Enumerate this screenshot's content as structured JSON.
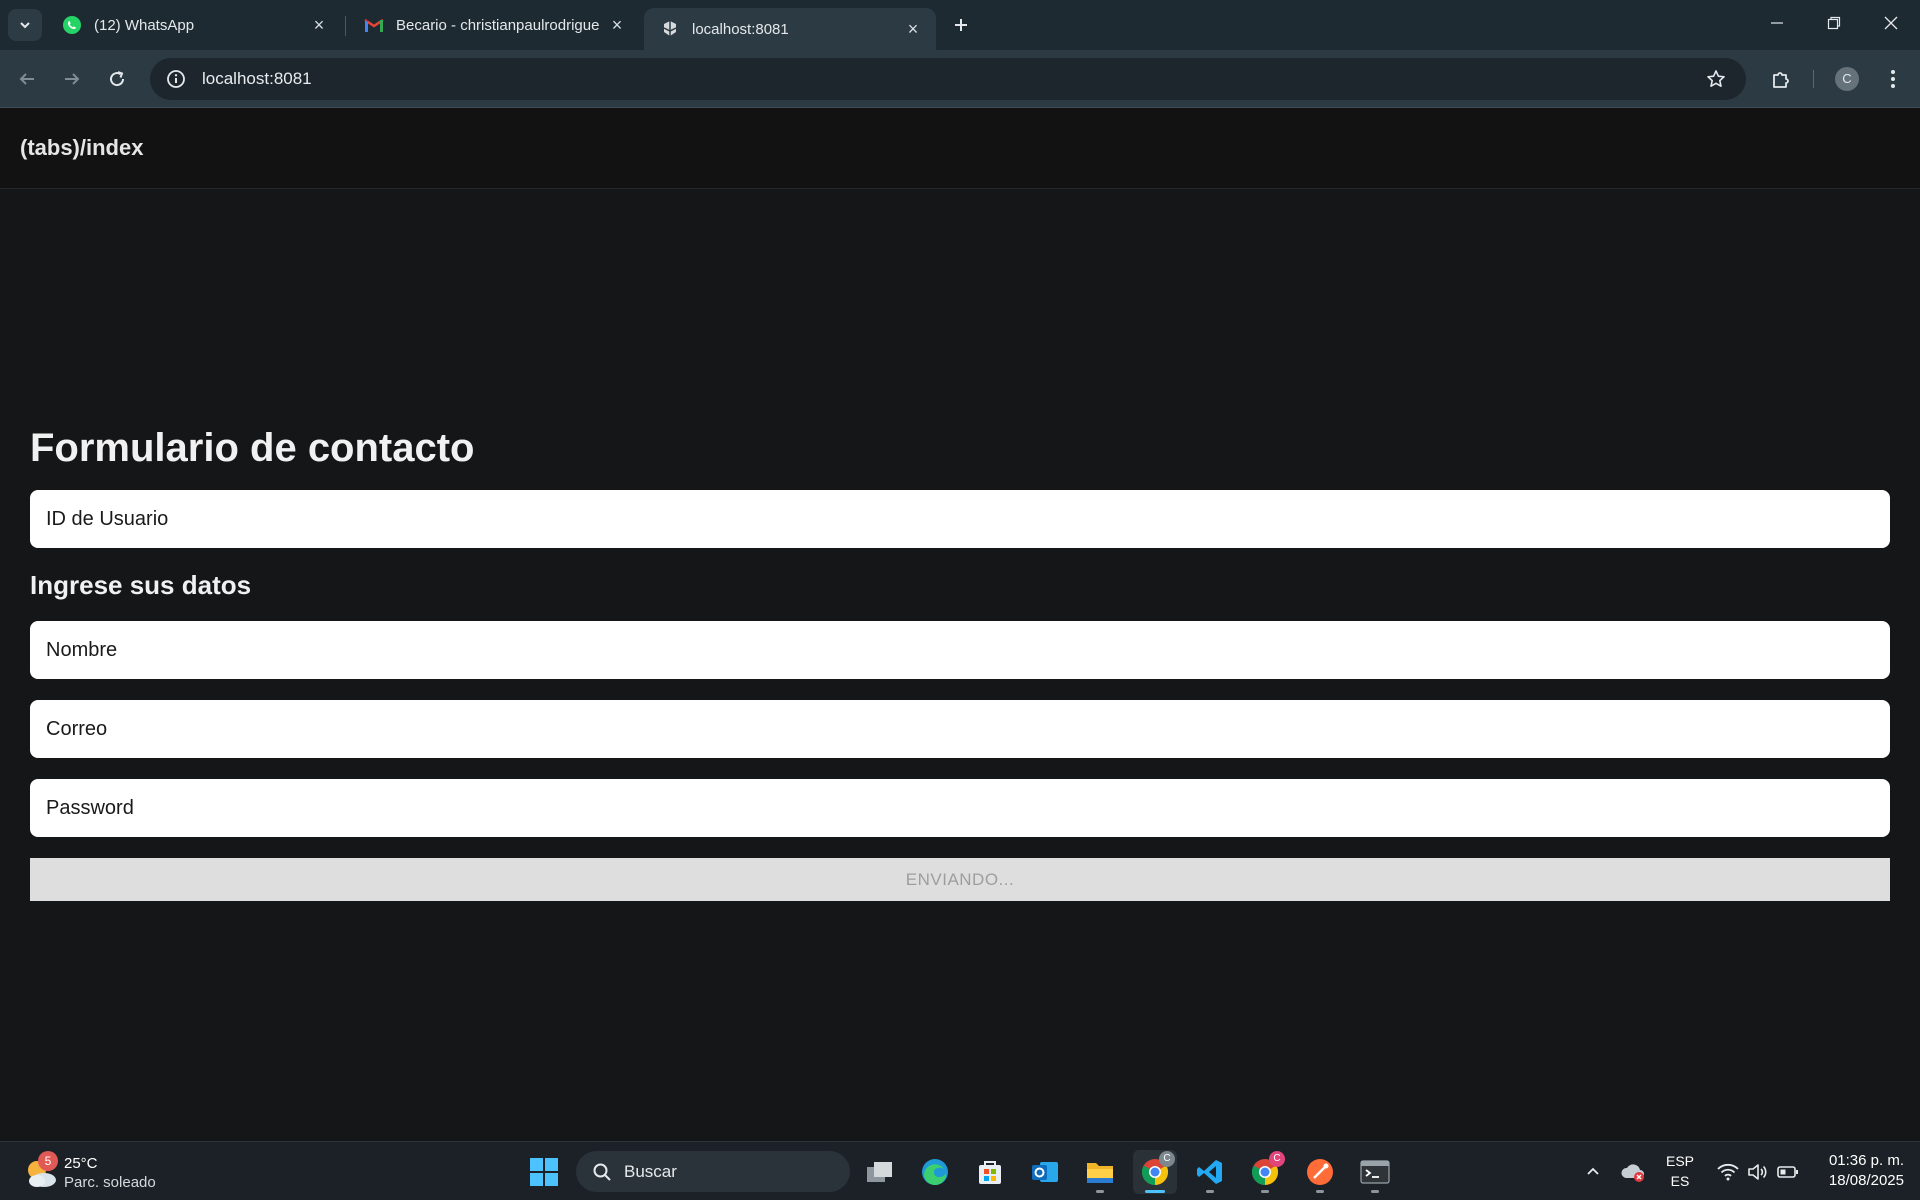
{
  "browser": {
    "tabs": [
      {
        "title": "(12) WhatsApp"
      },
      {
        "title": "Becario - christianpaulrodriguez"
      },
      {
        "title": "localhost:8081"
      }
    ],
    "url": "localhost:8081",
    "profile_initial": "C"
  },
  "app": {
    "header_title": "(tabs)/index",
    "form": {
      "title": "Formulario de contacto",
      "user_id_placeholder": "ID de Usuario",
      "subtitle": "Ingrese sus datos",
      "name_placeholder": "Nombre",
      "email_placeholder": "Correo",
      "password_placeholder": "Password",
      "submit_label": "ENVIANDO..."
    }
  },
  "taskbar": {
    "weather": {
      "badge": "5",
      "temp": "25°C",
      "condition": "Parc. soleado"
    },
    "search_label": "Buscar",
    "language": {
      "line1": "ESP",
      "line2": "ES"
    },
    "clock": {
      "time": "01:36 p. m.",
      "date": "18/08/2025"
    },
    "chrome_badge": "C"
  },
  "colors": {
    "page_bg": "#151618",
    "header_bg": "#121212",
    "browser_frame": "#2b3a43"
  }
}
